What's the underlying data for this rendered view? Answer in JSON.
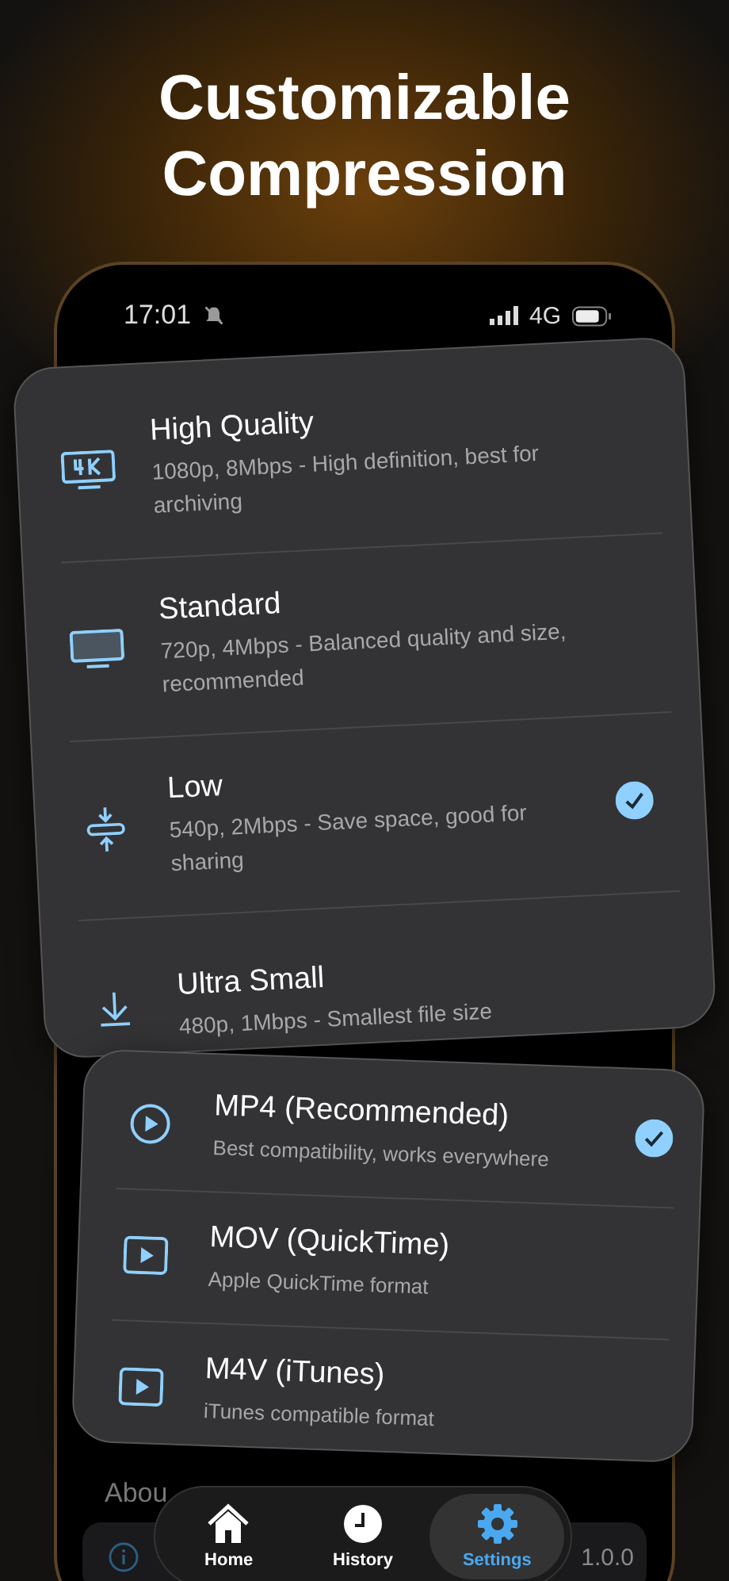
{
  "headline": "Customizable Compression",
  "status_bar": {
    "time": "17:01",
    "network": "4G"
  },
  "quality_options": [
    {
      "title": "High Quality",
      "description": "1080p, 8Mbps - High definition, best for archiving",
      "selected": false
    },
    {
      "title": "Standard",
      "description": "720p, 4Mbps - Balanced quality and size, recommended",
      "selected": false
    },
    {
      "title": "Low",
      "description": "540p, 2Mbps - Save space, good for sharing",
      "selected": true
    },
    {
      "title": "Ultra Small",
      "description": "480p, 1Mbps - Smallest file size",
      "selected": false
    }
  ],
  "format_options": [
    {
      "title": "MP4 (Recommended)",
      "description": "Best compatibility, works everywhere",
      "selected": true
    },
    {
      "title": "MOV (QuickTime)",
      "description": "Apple QuickTime format",
      "selected": false
    },
    {
      "title": "M4V (iTunes)",
      "description": "iTunes compatible format",
      "selected": false
    }
  ],
  "about": {
    "heading": "Abou",
    "row_value": "1.0.0"
  },
  "tabs": [
    {
      "label": "Home",
      "selected": false
    },
    {
      "label": "History",
      "selected": false
    },
    {
      "label": "Settings",
      "selected": true
    }
  ]
}
